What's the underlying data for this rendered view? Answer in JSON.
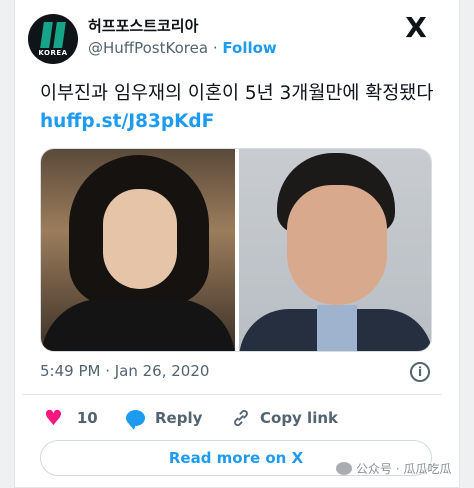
{
  "account": {
    "display_name": "허프포스트코리아",
    "handle": "@HuffPostKorea",
    "separator": "·",
    "follow_label": "Follow",
    "avatar_text": "KOREA"
  },
  "x_logo": "X",
  "tweet": {
    "text": "이부진과 임우재의 이혼이 5년 3개월만에 확정됐다 ",
    "link": "huffp.st/J83pKdF"
  },
  "meta": {
    "timestamp": "5:49 PM · Jan 26, 2020",
    "info_icon": "i"
  },
  "actions": {
    "like_icon": "♥",
    "like_count": "10",
    "reply_label": "Reply",
    "copy_link_label": "Copy link"
  },
  "read_more_label": "Read more on X",
  "watermark": "公众号 · 瓜瓜吃瓜",
  "colors": {
    "accent": "#1d9bf0",
    "like": "#f91880",
    "text": "#0f1419",
    "muted": "#536471"
  }
}
